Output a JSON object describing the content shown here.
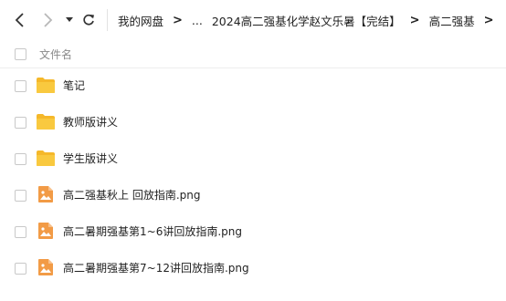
{
  "toolbar": {
    "back_icon": "chevron-left-icon",
    "forward_icon": "chevron-right-icon",
    "history_icon": "caret-down-icon",
    "refresh_icon": "refresh-icon"
  },
  "breadcrumb": {
    "items": [
      "我的网盘",
      "...",
      "2024高二强基化学赵文乐暑【完结】",
      "高二强基"
    ],
    "separator": ">"
  },
  "list": {
    "header_label": "文件名",
    "rows": [
      {
        "name": "笔记",
        "type": "folder-icon"
      },
      {
        "name": "教师版讲义",
        "type": "folder-icon"
      },
      {
        "name": "学生版讲义",
        "type": "folder-icon"
      },
      {
        "name": "高二强基秋上 回放指南.png",
        "type": "image-file-icon"
      },
      {
        "name": "高二暑期强基第1~6讲回放指南.png",
        "type": "image-file-icon"
      },
      {
        "name": "高二暑期强基第7~12讲回放指南.png",
        "type": "image-file-icon"
      }
    ]
  },
  "colors": {
    "folder": "#f9c93f",
    "image_file": "#f29b46",
    "header_text": "#8a8a8a"
  }
}
